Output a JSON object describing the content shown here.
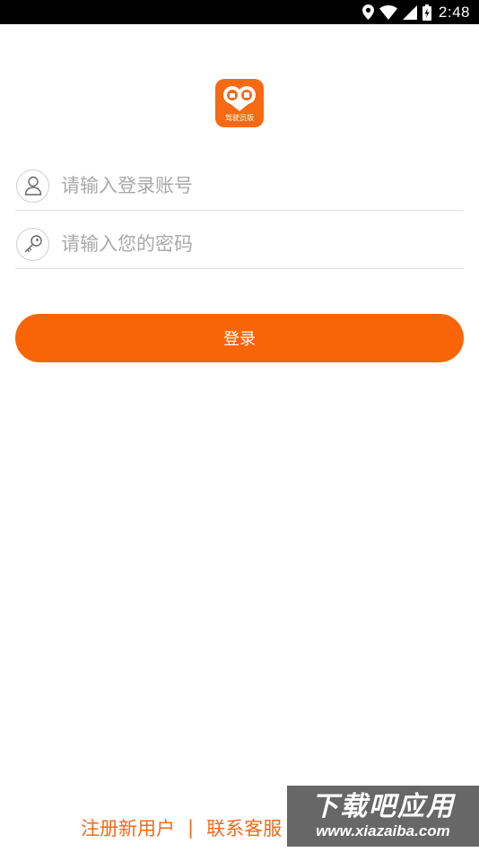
{
  "status_bar": {
    "time": "2:48",
    "icons": [
      "location-icon",
      "wifi-icon",
      "cell-signal-icon",
      "battery-charging-icon"
    ]
  },
  "logo": {
    "caption": "驾驶员版",
    "color": "#f56a12"
  },
  "form": {
    "username": {
      "value": "",
      "placeholder": "请输入登录账号",
      "icon": "user-icon"
    },
    "password": {
      "value": "",
      "placeholder": "请输入您的密码",
      "icon": "key-icon"
    },
    "login_label": "登录"
  },
  "footer": {
    "register_label": "注册新用户",
    "separator": "|",
    "contact_label": "联系客服"
  },
  "watermark": {
    "title": "下载吧应用",
    "url": "www.xiazaiba.com"
  },
  "colors": {
    "accent": "#f96407",
    "link": "#f26a1b",
    "placeholder": "#a9a9a9",
    "divider": "#e2e2e2"
  }
}
